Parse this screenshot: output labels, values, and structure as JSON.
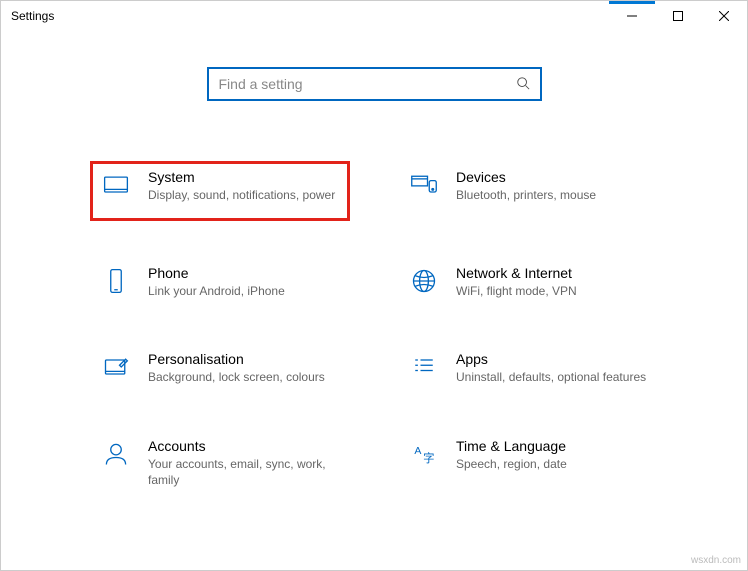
{
  "window": {
    "title": "Settings"
  },
  "search": {
    "placeholder": "Find a setting"
  },
  "tiles": {
    "system": {
      "title": "System",
      "desc": "Display, sound, notifications, power"
    },
    "devices": {
      "title": "Devices",
      "desc": "Bluetooth, printers, mouse"
    },
    "phone": {
      "title": "Phone",
      "desc": "Link your Android, iPhone"
    },
    "network": {
      "title": "Network & Internet",
      "desc": "WiFi, flight mode, VPN"
    },
    "personalisation": {
      "title": "Personalisation",
      "desc": "Background, lock screen, colours"
    },
    "apps": {
      "title": "Apps",
      "desc": "Uninstall, defaults, optional features"
    },
    "accounts": {
      "title": "Accounts",
      "desc": "Your accounts, email, sync, work, family"
    },
    "timelang": {
      "title": "Time & Language",
      "desc": "Speech, region, date"
    }
  },
  "watermark": "wsxdn.com",
  "colors": {
    "accent": "#0067c0",
    "highlight": "#e2231a"
  }
}
